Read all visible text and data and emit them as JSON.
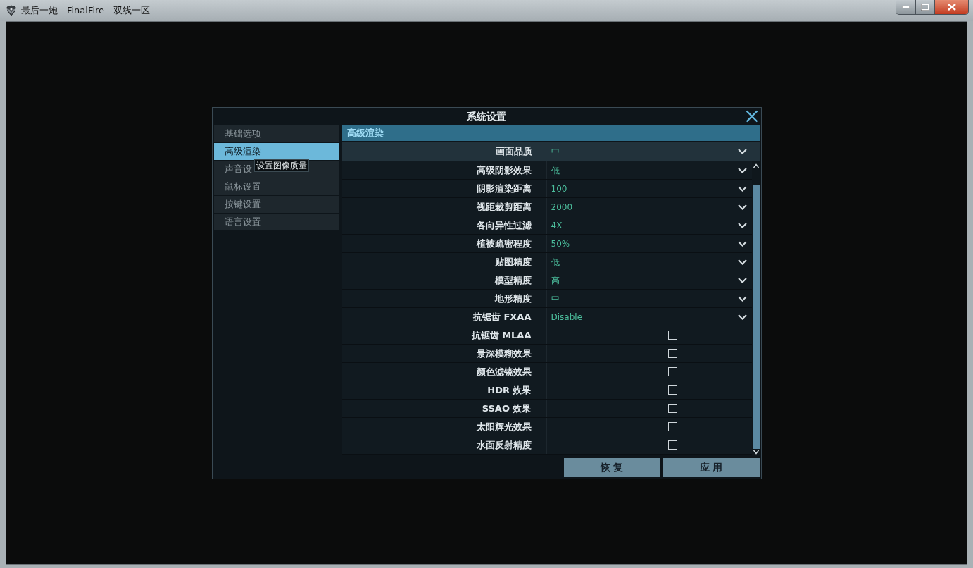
{
  "window": {
    "title": "最后一炮 - FinalFire - 双线一区"
  },
  "dialog": {
    "title": "系统设置",
    "sidebar": {
      "items": [
        {
          "label": "基础选项",
          "selected": false
        },
        {
          "label": "高级渲染",
          "selected": true
        },
        {
          "label": "声音设",
          "selected": false
        },
        {
          "label": "鼠标设置",
          "selected": false
        },
        {
          "label": "按键设置",
          "selected": false
        },
        {
          "label": "语言设置",
          "selected": false
        }
      ]
    },
    "tooltip": "设置图像质量",
    "section_header": "高级渲染",
    "preset": {
      "label": "画面品质",
      "value": "中"
    },
    "rows": [
      {
        "kind": "dropdown",
        "label": "高级阴影效果",
        "value": "低"
      },
      {
        "kind": "dropdown",
        "label": "阴影渲染距离",
        "value": "100"
      },
      {
        "kind": "dropdown",
        "label": "视距裁剪距离",
        "value": "2000"
      },
      {
        "kind": "dropdown",
        "label": "各向异性过滤",
        "value": "4X"
      },
      {
        "kind": "dropdown",
        "label": "植被疏密程度",
        "value": "50%"
      },
      {
        "kind": "dropdown",
        "label": "贴图精度",
        "value": "低"
      },
      {
        "kind": "dropdown",
        "label": "模型精度",
        "value": "高"
      },
      {
        "kind": "dropdown",
        "label": "地形精度",
        "value": "中"
      },
      {
        "kind": "dropdown",
        "label": "抗锯齿 FXAA",
        "value": "Disable"
      },
      {
        "kind": "checkbox",
        "label": "抗锯齿 MLAA",
        "checked": false
      },
      {
        "kind": "checkbox",
        "label": "景深模糊效果",
        "checked": false
      },
      {
        "kind": "checkbox",
        "label": "颜色滤镜效果",
        "checked": false
      },
      {
        "kind": "checkbox",
        "label": "HDR 效果",
        "checked": false
      },
      {
        "kind": "checkbox",
        "label": "SSAO 效果",
        "checked": false
      },
      {
        "kind": "checkbox",
        "label": "太阳辉光效果",
        "checked": false
      },
      {
        "kind": "checkbox",
        "label": "水面反射精度",
        "checked": false
      }
    ],
    "buttons": [
      "恢 复",
      "应 用"
    ]
  }
}
